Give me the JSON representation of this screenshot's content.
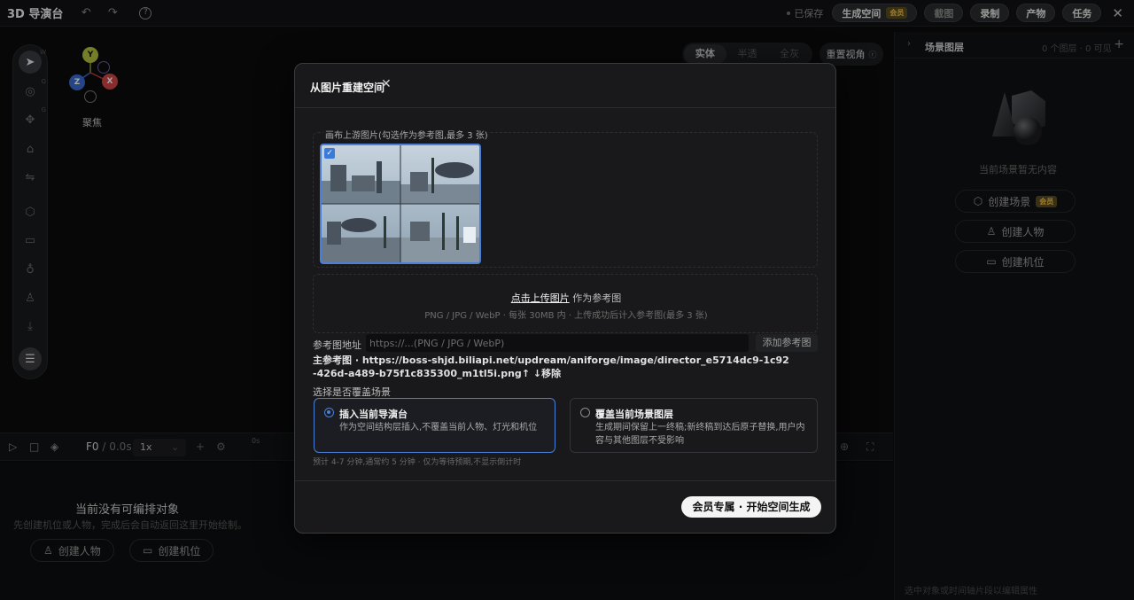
{
  "topbar": {
    "app_title": "3D 导演台",
    "undo_icon": "undo-icon",
    "redo_icon": "redo-icon",
    "help_icon": "help-icon",
    "saved": "已保存",
    "generate_space": "生成空间",
    "vip_badge": "会员",
    "screenshot": "截图",
    "record": "录制",
    "product": "产物",
    "tasks": "任务",
    "close_icon": "close-icon"
  },
  "toolbar": {
    "tools": [
      "select-icon",
      "orbit-icon",
      "move-icon",
      "tag-icon",
      "link-icon",
      "cube-icon",
      "camera-icon",
      "light-icon",
      "person-icon",
      "import-icon",
      "settings-icon"
    ],
    "hotkeys": [
      "W",
      "Q",
      "G"
    ]
  },
  "viewport": {
    "gizmo_axes": [
      "Y",
      "Z",
      "X"
    ],
    "focus_label": "聚焦",
    "render_modes": [
      "实体",
      "半透",
      "全灰"
    ],
    "active_mode": "实体",
    "reset_view": "重置视角"
  },
  "timeline": {
    "frame": "F0",
    "time": "/ 0.0s",
    "speed": "1x",
    "ruler_start": "0s"
  },
  "lower_panel": {
    "empty_title": "当前没有可编排对象",
    "empty_sub": "先创建机位或人物，完成后会自动返回这里开始绘制。",
    "create_person": "创建人物",
    "create_camera": "创建机位"
  },
  "right_panel": {
    "title": "场景图层",
    "count": "0 个图层 · 0 可见",
    "empty": "当前场景暂无内容",
    "create_scene": "创建场景",
    "vip_badge": "会员",
    "create_person": "创建人物",
    "create_camera": "创建机位",
    "footer": "选中对象或时间轴片段以编辑属性"
  },
  "modal": {
    "title": "从图片重建空间",
    "close_icon": "close-icon",
    "canvas_images_label": "画布上游图片(勾选作为参考图,最多 3 张)",
    "upload_link": "点击上传图片",
    "upload_suffix": "作为参考图",
    "upload_hint": "PNG / JPG / WebP · 每张 30MB 内 · 上传成功后计入参考图(最多 3 张)",
    "ref_url_label": "参考图地址",
    "ref_url_placeholder": "https://...(PNG / JPG / WebP)",
    "add_ref": "添加参考图",
    "main_ref_prefix": "主参考图 · ",
    "main_ref_url": "https://boss-shjd.biliapi.net/updream/aniforge/image/director_e5714dc9-1c92-426d-a489-b75f1c835300_m1tl5i.png",
    "main_ref_actions": "↑ ↓移除",
    "cover_label": "选择是否覆盖场景",
    "options": [
      {
        "title": "插入当前导演台",
        "desc": "作为空间结构层插入,不覆盖当前人物、灯光和机位",
        "selected": true
      },
      {
        "title": "覆盖当前场景图层",
        "desc": "生成期间保留上一终稿;新终稿到达后原子替换,用户内容与其他图层不受影响",
        "selected": false
      }
    ],
    "eta": "预计 4-7 分钟,通常约 5 分钟 · 仅为等待预期,不显示倒计时",
    "start_button": "会员专属 · 开始空间生成"
  }
}
